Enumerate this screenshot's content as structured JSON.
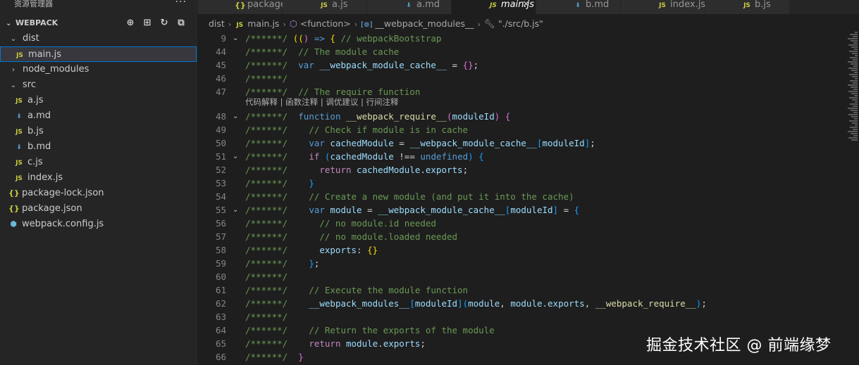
{
  "sidebar": {
    "title": "资源管理器",
    "more": "···",
    "section": "WEBPACK",
    "actions": [
      "new-file-icon",
      "new-folder-icon",
      "refresh-icon",
      "collapse-all-icon"
    ],
    "tree": [
      {
        "label": "dist",
        "type": "folder",
        "expanded": true,
        "depth": 1
      },
      {
        "label": "main.js",
        "type": "js",
        "depth": 2,
        "selected": true
      },
      {
        "label": "node_modules",
        "type": "folder",
        "expanded": false,
        "depth": 1
      },
      {
        "label": "src",
        "type": "folder",
        "expanded": true,
        "depth": 1
      },
      {
        "label": "a.js",
        "type": "js",
        "depth": 2
      },
      {
        "label": "a.md",
        "type": "md",
        "depth": 2
      },
      {
        "label": "b.js",
        "type": "js",
        "depth": 2
      },
      {
        "label": "b.md",
        "type": "md",
        "depth": 2
      },
      {
        "label": "c.js",
        "type": "js",
        "depth": 2
      },
      {
        "label": "index.js",
        "type": "js",
        "depth": 2
      },
      {
        "label": "package-lock.json",
        "type": "json",
        "depth": 1
      },
      {
        "label": "package.json",
        "type": "json",
        "depth": 1
      },
      {
        "label": "webpack.config.js",
        "type": "webpack",
        "depth": 1
      }
    ]
  },
  "tabs": [
    {
      "label": "package.json",
      "type": "json"
    },
    {
      "label": "a.js",
      "type": "js"
    },
    {
      "label": "a.md",
      "type": "md"
    },
    {
      "label": "main.js",
      "type": "js",
      "active": true,
      "close": "✕"
    },
    {
      "label": "b.md",
      "type": "md"
    },
    {
      "label": "index.js",
      "type": "js"
    },
    {
      "label": "b.js",
      "type": "js"
    }
  ],
  "breadcrumb": {
    "folder": "dist",
    "file": "main.js",
    "fn": "<function>",
    "modules": "__webpack_modules__",
    "path": "\"./src/b.js\""
  },
  "editor": {
    "codelens": "代码解释 | 函数注释 | 调优建议 | 行间注释",
    "lines": [
      {
        "n": "9",
        "fold": "⌄",
        "code": [
          [
            "c",
            "/******/ "
          ],
          [
            "b1",
            "(("
          ],
          [
            "b2",
            ")"
          ],
          [
            "k",
            " =>"
          ],
          [
            "b1",
            " {"
          ],
          [
            "c",
            " // webpackBootstrap"
          ]
        ]
      },
      {
        "n": "44",
        "code": [
          [
            "c",
            "/******/  // The module cache"
          ]
        ]
      },
      {
        "n": "45",
        "code": [
          [
            "c",
            "/******/  "
          ],
          [
            "k",
            "var"
          ],
          [
            "v",
            " __webpack_module_cache__"
          ],
          [
            "p",
            " = "
          ],
          [
            "b2",
            "{}"
          ],
          [
            "p",
            ";"
          ]
        ]
      },
      {
        "n": "46",
        "code": [
          [
            "c",
            "/******/"
          ]
        ]
      },
      {
        "n": "47",
        "code": [
          [
            "c",
            "/******/  // The require function"
          ]
        ]
      },
      {
        "n": "48",
        "fold": "⌄",
        "code": [
          [
            "c",
            "/******/  "
          ],
          [
            "k",
            "function"
          ],
          [
            "f",
            " __webpack_require__"
          ],
          [
            "b2",
            "("
          ],
          [
            "v",
            "moduleId"
          ],
          [
            "b2",
            ")"
          ],
          [
            "b2",
            " {"
          ]
        ]
      },
      {
        "n": "49",
        "code": [
          [
            "c",
            "/******/    // Check if module is in cache"
          ]
        ]
      },
      {
        "n": "50",
        "code": [
          [
            "c",
            "/******/    "
          ],
          [
            "k",
            "var"
          ],
          [
            "v",
            " cachedModule"
          ],
          [
            "p",
            " = "
          ],
          [
            "v",
            "__webpack_module_cache__"
          ],
          [
            "b3",
            "["
          ],
          [
            "v",
            "moduleId"
          ],
          [
            "b3",
            "]"
          ],
          [
            "p",
            ";"
          ]
        ]
      },
      {
        "n": "51",
        "fold": "⌄",
        "code": [
          [
            "c",
            "/******/    "
          ],
          [
            "kr",
            "if"
          ],
          [
            "p",
            " "
          ],
          [
            "b3",
            "("
          ],
          [
            "v",
            "cachedModule"
          ],
          [
            "p",
            " !== "
          ],
          [
            "k",
            "undefined"
          ],
          [
            "b3",
            ")"
          ],
          [
            "b3",
            " {"
          ]
        ]
      },
      {
        "n": "52",
        "code": [
          [
            "c",
            "/******/      "
          ],
          [
            "kr",
            "return"
          ],
          [
            "v",
            " cachedModule"
          ],
          [
            "p",
            "."
          ],
          [
            "v",
            "exports"
          ],
          [
            "p",
            ";"
          ]
        ]
      },
      {
        "n": "53",
        "code": [
          [
            "c",
            "/******/    "
          ],
          [
            "b3",
            "}"
          ]
        ]
      },
      {
        "n": "54",
        "code": [
          [
            "c",
            "/******/    // Create a new module (and put it into the cache)"
          ]
        ]
      },
      {
        "n": "55",
        "fold": "⌄",
        "code": [
          [
            "c",
            "/******/    "
          ],
          [
            "k",
            "var"
          ],
          [
            "v",
            " module"
          ],
          [
            "p",
            " = "
          ],
          [
            "v",
            "__webpack_module_cache__"
          ],
          [
            "b3",
            "["
          ],
          [
            "v",
            "moduleId"
          ],
          [
            "b3",
            "]"
          ],
          [
            "p",
            " = "
          ],
          [
            "b3",
            "{"
          ]
        ]
      },
      {
        "n": "56",
        "code": [
          [
            "c",
            "/******/      // no module.id needed"
          ]
        ]
      },
      {
        "n": "57",
        "code": [
          [
            "c",
            "/******/      // no module.loaded needed"
          ]
        ]
      },
      {
        "n": "58",
        "code": [
          [
            "c",
            "/******/      "
          ],
          [
            "v",
            "exports"
          ],
          [
            "p",
            ": "
          ],
          [
            "b1",
            "{}"
          ]
        ]
      },
      {
        "n": "59",
        "code": [
          [
            "c",
            "/******/    "
          ],
          [
            "b3",
            "}"
          ],
          [
            "p",
            ";"
          ]
        ]
      },
      {
        "n": "60",
        "code": [
          [
            "c",
            "/******/"
          ]
        ]
      },
      {
        "n": "61",
        "code": [
          [
            "c",
            "/******/    // Execute the module function"
          ]
        ]
      },
      {
        "n": "62",
        "code": [
          [
            "c",
            "/******/    "
          ],
          [
            "v",
            "__webpack_modules__"
          ],
          [
            "b3",
            "["
          ],
          [
            "v",
            "moduleId"
          ],
          [
            "b3",
            "]"
          ],
          [
            "b3",
            "("
          ],
          [
            "v",
            "module"
          ],
          [
            "p",
            ", "
          ],
          [
            "v",
            "module"
          ],
          [
            "p",
            "."
          ],
          [
            "v",
            "exports"
          ],
          [
            "p",
            ", "
          ],
          [
            "f",
            "__webpack_require__"
          ],
          [
            "b3",
            ")"
          ],
          [
            "p",
            ";"
          ]
        ]
      },
      {
        "n": "63",
        "code": [
          [
            "c",
            "/******/"
          ]
        ]
      },
      {
        "n": "64",
        "code": [
          [
            "c",
            "/******/    // Return the exports of the module"
          ]
        ]
      },
      {
        "n": "65",
        "code": [
          [
            "c",
            "/******/    "
          ],
          [
            "kr",
            "return"
          ],
          [
            "v",
            " module"
          ],
          [
            "p",
            "."
          ],
          [
            "v",
            "exports"
          ],
          [
            "p",
            ";"
          ]
        ]
      },
      {
        "n": "66",
        "code": [
          [
            "c",
            "/******/  "
          ],
          [
            "b2",
            "}"
          ]
        ]
      }
    ]
  },
  "watermark": "掘金技术社区 @ 前端缘梦"
}
